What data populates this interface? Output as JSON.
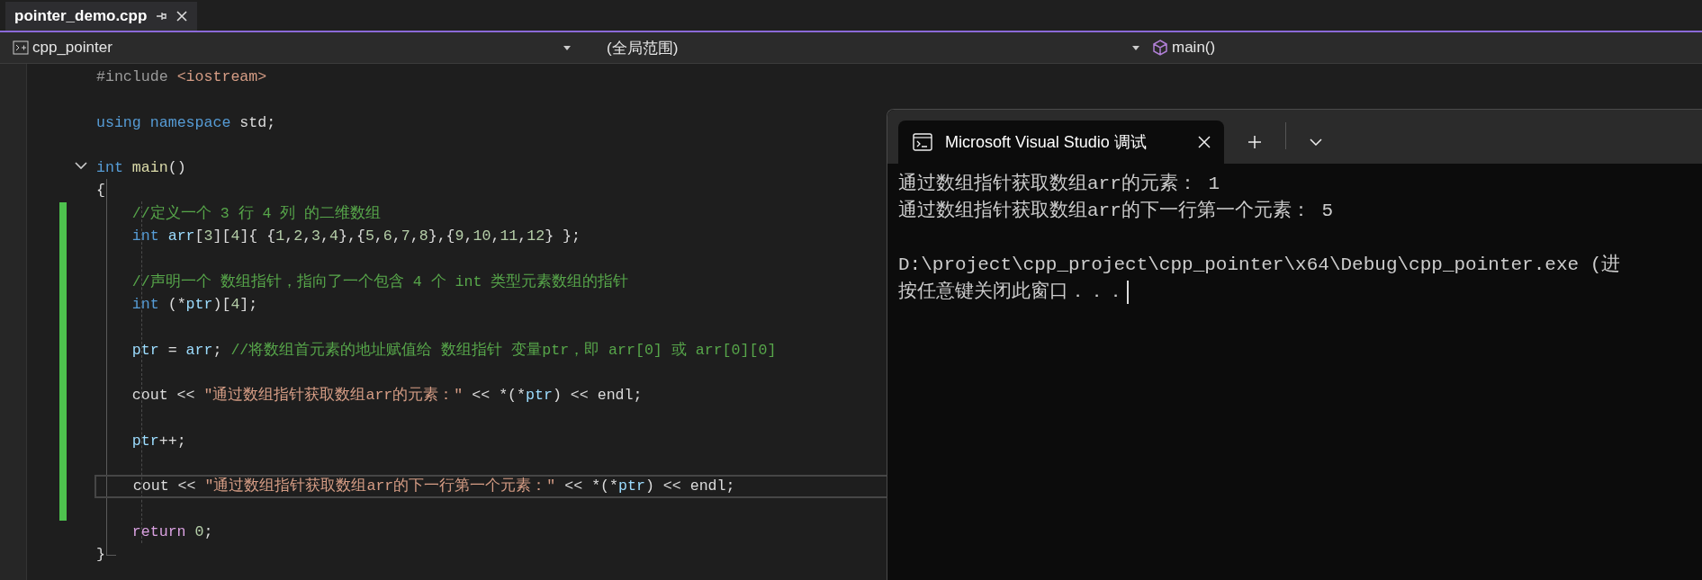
{
  "document_tabs": [
    {
      "label": "pointer_demo.cpp",
      "selected": true,
      "pinned": false
    }
  ],
  "navigation_bar": {
    "project": "cpp_pointer",
    "scope": "(全局范围)",
    "member": "main()"
  },
  "code": {
    "lines": [
      {
        "changed": false,
        "tokens": [
          {
            "kind": "pre",
            "text": "#include"
          },
          {
            "kind": "header",
            "text": " <iostream>"
          }
        ]
      },
      {
        "changed": false
      },
      {
        "changed": false,
        "tokens": [
          {
            "kind": "kw",
            "text": "using"
          },
          {
            "kind": "kw",
            "text": " namespace"
          },
          {
            "kind": "plain",
            "text": " std;"
          }
        ]
      },
      {
        "changed": false
      },
      {
        "changed": false,
        "tokens": [
          {
            "kind": "kw",
            "text": "int"
          },
          {
            "kind": "fn",
            "text": " main"
          },
          {
            "kind": "plain",
            "text": "()"
          }
        ],
        "expanded": true,
        "children": [
          {
            "changed": false,
            "tokens": [
              {
                "kind": "plain",
                "text": "{"
              }
            ]
          },
          {
            "changed": true,
            "tokens": [
              {
                "kind": "cmt",
                "text": "    //定义一个 3 行 4 列 的二维数组"
              }
            ]
          },
          {
            "changed": true,
            "tokens": [
              {
                "kind": "kw",
                "text": "    int"
              },
              {
                "kind": "id",
                "text": " arr"
              },
              {
                "kind": "plain",
                "text": "["
              },
              {
                "kind": "num",
                "text": "3"
              },
              {
                "kind": "plain",
                "text": "]["
              },
              {
                "kind": "num",
                "text": "4"
              },
              {
                "kind": "plain",
                "text": "]{ {"
              },
              {
                "kind": "num",
                "text": "1"
              },
              {
                "kind": "plain",
                "text": ","
              },
              {
                "kind": "num",
                "text": "2"
              },
              {
                "kind": "plain",
                "text": ","
              },
              {
                "kind": "num",
                "text": "3"
              },
              {
                "kind": "plain",
                "text": ","
              },
              {
                "kind": "num",
                "text": "4"
              },
              {
                "kind": "plain",
                "text": "},{"
              },
              {
                "kind": "num",
                "text": "5"
              },
              {
                "kind": "plain",
                "text": ","
              },
              {
                "kind": "num",
                "text": "6"
              },
              {
                "kind": "plain",
                "text": ","
              },
              {
                "kind": "num",
                "text": "7"
              },
              {
                "kind": "plain",
                "text": ","
              },
              {
                "kind": "num",
                "text": "8"
              },
              {
                "kind": "plain",
                "text": "},{"
              },
              {
                "kind": "num",
                "text": "9"
              },
              {
                "kind": "plain",
                "text": ","
              },
              {
                "kind": "num",
                "text": "10"
              },
              {
                "kind": "plain",
                "text": ","
              },
              {
                "kind": "num",
                "text": "11"
              },
              {
                "kind": "plain",
                "text": ","
              },
              {
                "kind": "num",
                "text": "12"
              },
              {
                "kind": "plain",
                "text": "} };"
              }
            ]
          },
          {
            "changed": true
          },
          {
            "changed": true,
            "tokens": [
              {
                "kind": "cmt",
                "text": "    //声明一个 数组指针，指向了一个包含 4 个 int 类型元素数组的指针"
              }
            ]
          },
          {
            "changed": true,
            "tokens": [
              {
                "kind": "kw",
                "text": "    int"
              },
              {
                "kind": "plain",
                "text": " (*"
              },
              {
                "kind": "id",
                "text": "ptr"
              },
              {
                "kind": "plain",
                "text": ")["
              },
              {
                "kind": "num",
                "text": "4"
              },
              {
                "kind": "plain",
                "text": "];"
              }
            ]
          },
          {
            "changed": true
          },
          {
            "changed": true,
            "tokens": [
              {
                "kind": "id",
                "text": "    ptr"
              },
              {
                "kind": "plain",
                "text": " = "
              },
              {
                "kind": "id",
                "text": "arr"
              },
              {
                "kind": "plain",
                "text": "; "
              },
              {
                "kind": "cmt",
                "text": "//将数组首元素的地址赋值给 数组指针 变量ptr，即 arr[0] 或 arr[0][0]"
              }
            ]
          },
          {
            "changed": true
          },
          {
            "changed": true,
            "tokens": [
              {
                "kind": "plain",
                "text": "    cout << "
              },
              {
                "kind": "str",
                "text": "\"通过数组指针获取数组arr的元素：\""
              },
              {
                "kind": "plain",
                "text": " << *(*"
              },
              {
                "kind": "id",
                "text": "ptr"
              },
              {
                "kind": "plain",
                "text": ") << endl;"
              }
            ]
          },
          {
            "changed": true
          },
          {
            "changed": true,
            "tokens": [
              {
                "kind": "id",
                "text": "    ptr"
              },
              {
                "kind": "plain",
                "text": "++;"
              }
            ]
          },
          {
            "changed": true
          },
          {
            "changed": true,
            "current": true,
            "tokens": [
              {
                "kind": "plain",
                "text": "    cout << "
              },
              {
                "kind": "str",
                "text": "\"通过数组指针获取数组arr的下一行第一个元素：\""
              },
              {
                "kind": "plain",
                "text": " << *(*"
              },
              {
                "kind": "id",
                "text": "ptr"
              },
              {
                "kind": "plain",
                "text": ") << endl;"
              }
            ]
          },
          {
            "changed": true
          },
          {
            "changed": false,
            "tokens": [
              {
                "kind": "ctl",
                "text": "    return"
              },
              {
                "kind": "num",
                "text": " 0"
              },
              {
                "kind": "plain",
                "text": ";"
              }
            ]
          },
          {
            "changed": false,
            "tokens": [
              {
                "kind": "plain",
                "text": "}"
              }
            ]
          }
        ]
      }
    ]
  },
  "console": {
    "tab_title": "Microsoft Visual Studio 调试",
    "output": [
      "通过数组指针获取数组arr的元素： 1",
      "通过数组指针获取数组arr的下一行第一个元素： 5"
    ],
    "exit_message": [
      "D:\\project\\cpp_project\\cpp_pointer\\x64\\Debug\\cpp_pointer.exe (进",
      "按任意键关闭此窗口．．．"
    ]
  }
}
